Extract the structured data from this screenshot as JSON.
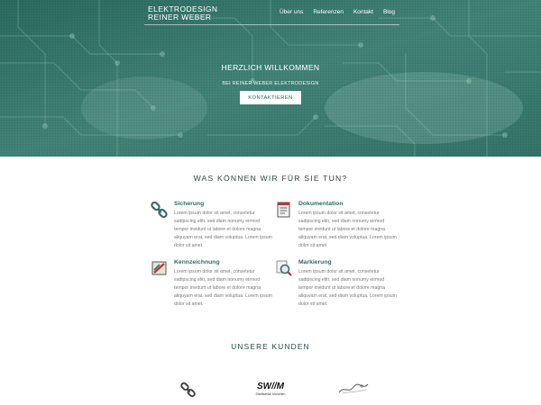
{
  "header": {
    "logo_line1": "ELEKTRODESIGN",
    "logo_line2": "REINER WEBER",
    "nav": [
      "Über uns",
      "Referenzen",
      "Kontakt",
      "Blog"
    ]
  },
  "hero": {
    "title": "HERZLICH WILLKOMMEN",
    "subtitle": "BEI REINER WEBER ELEKTRODESIGN",
    "cta_label": "KONTAKTIEREN"
  },
  "services": {
    "title": "WAS KÖNNEN WIR FÜR SIE TUN?",
    "items": [
      {
        "title": "Sicherung",
        "icon": "chain-link-icon",
        "text": "Lorem ipsum dolor sit amet, consetetur sadipscing elitr, sed diam nonumy eirmod tempor invidunt ut labore et dolore magna aliquyam erat, sed diam voluptua. Lorem ipsum dolor sit amet."
      },
      {
        "title": "Dokumentation",
        "icon": "document-icon",
        "text": "Lorem ipsum dolor sit amet, consetetur sadipscing elitr, sed diam nonumy eirmod tempor invidunt ut labore et dolore magna aliquyam erat, sed diam voluptua. Lorem ipsum dolor sit amet."
      },
      {
        "title": "Kennzeichnung",
        "icon": "label-pen-icon",
        "text": "Lorem ipsum dolor sit amet, consetetur sadipscing elitr, sed diam nonumy eirmod tempor invidunt ut labore et dolore magna aliquyam erat, sed diam voluptua. Lorem ipsum dolor sit amet."
      },
      {
        "title": "Markierung",
        "icon": "magnifier-icon",
        "text": "Lorem ipsum dolor sit amet, consetetur sadipscing elitr, sed diam nonumy eirmod tempor invidunt ut labore et dolore magna aliquyam erat, sed diam voluptua. Lorem ipsum dolor sit amet."
      }
    ]
  },
  "clients": {
    "title": "UNSERE KUNDEN",
    "logos": [
      {
        "icon": "chain-link-icon"
      },
      {
        "icon": "swm-logo",
        "name": "SW//M",
        "caption": "Stadtwerke München"
      },
      {
        "icon": "signature-logo"
      }
    ]
  },
  "colors": {
    "hero": "#3f7d72",
    "accent": "#2e6e67",
    "heading": "#2a4a4a"
  }
}
